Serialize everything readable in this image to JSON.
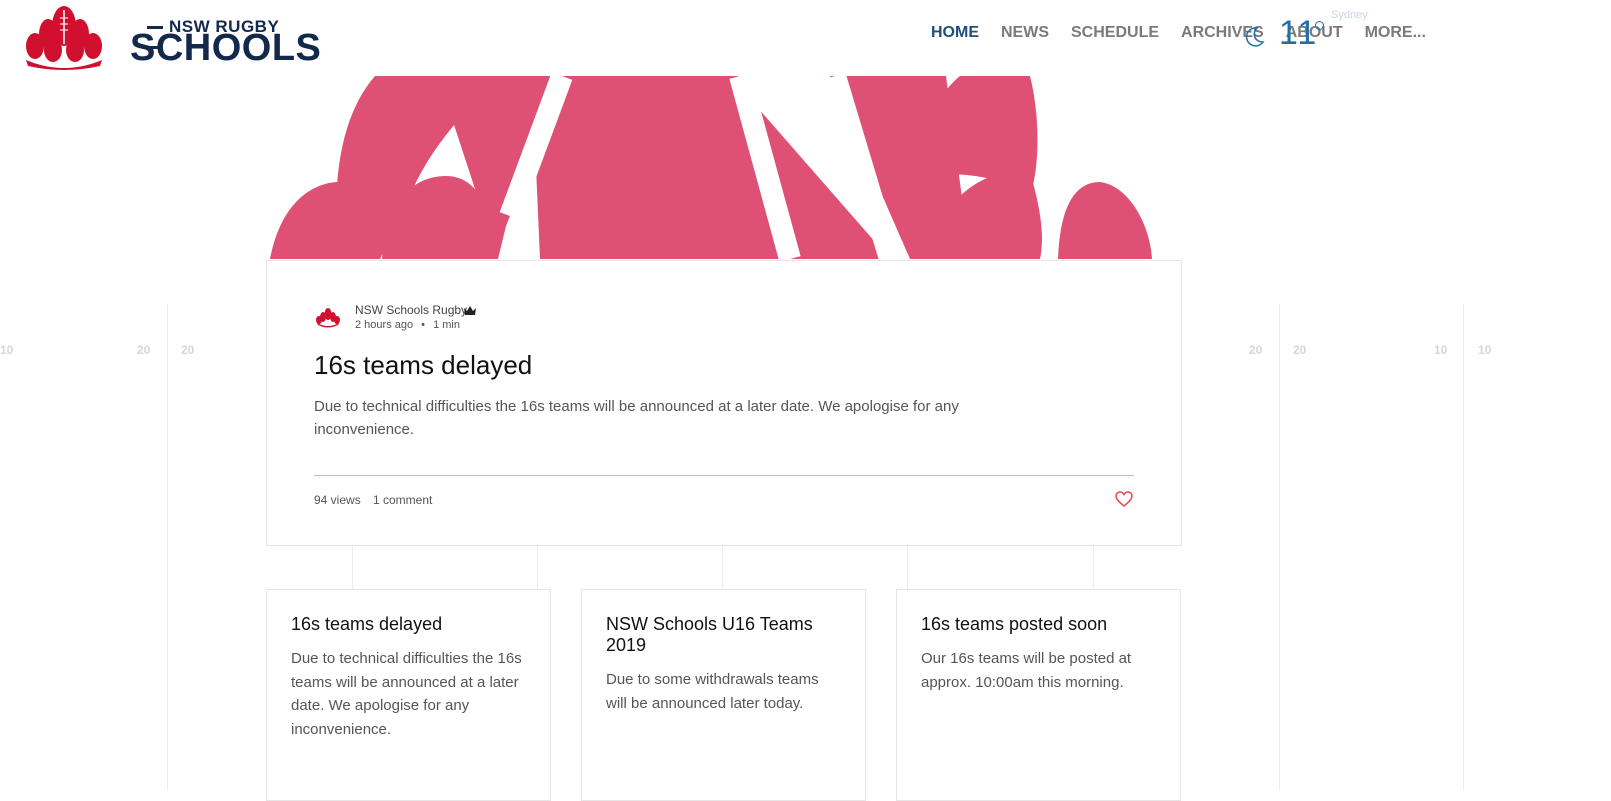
{
  "brand": {
    "top_text": "NSW RUGBY",
    "main_text": "SCHOOLS",
    "colors": {
      "navy": "#13294b",
      "red": "#d0102e",
      "pink": "#df5174"
    }
  },
  "nav": {
    "items": [
      {
        "label": "HOME",
        "active": true
      },
      {
        "label": "NEWS",
        "active": false
      },
      {
        "label": "SCHEDULE",
        "active": false
      },
      {
        "label": "ARCHIVES",
        "active": false
      },
      {
        "label": "ABOUT",
        "active": false
      },
      {
        "label": "MORE...",
        "active": false
      }
    ]
  },
  "weather": {
    "icon": "moon-icon",
    "temperature": "11",
    "city": "Sydney"
  },
  "background_ticks": [
    "10",
    "20",
    "20",
    "20",
    "20",
    "10",
    "10"
  ],
  "post": {
    "author": "NSW Schools Rugby",
    "time_ago": "2 hours ago",
    "separator": "•",
    "read_time": "1 min",
    "title": "16s teams delayed",
    "excerpt": "Due to technical difficulties the 16s teams will be announced at a later date. We apologise for any inconvenience.",
    "views": "94 views",
    "comments": "1 comment"
  },
  "cards": [
    {
      "title": "16s teams delayed",
      "excerpt": "Due to technical difficulties the 16s teams will be announced at a later date. We apologise for any inconvenience."
    },
    {
      "title": "NSW Schools U16 Teams 2019",
      "excerpt": "Due to some withdrawals teams will be announced later today."
    },
    {
      "title": "16s teams posted soon",
      "excerpt": "Our 16s teams will be posted at approx. 10:00am this morning."
    }
  ]
}
